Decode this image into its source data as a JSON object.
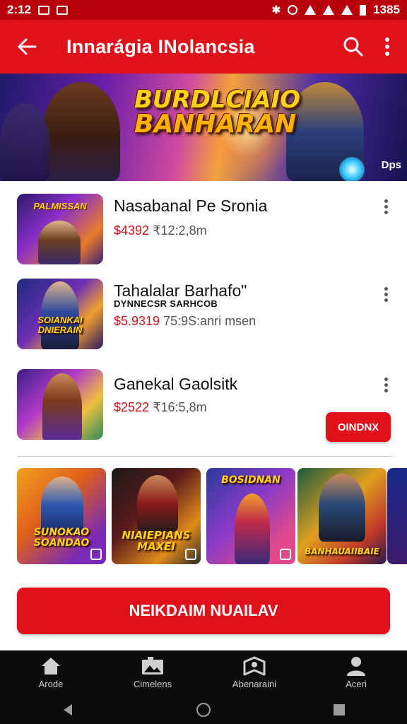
{
  "status_bar": {
    "time": "2:12",
    "battery": "1385"
  },
  "app_bar": {
    "title": "Innarágia INolancsia"
  },
  "banner": {
    "logo_line1": "BURDLCIAIO",
    "logo_line2": "BANHARAN",
    "corner_text": "Dps"
  },
  "items": [
    {
      "title": "Nasabanal Pe Sronia",
      "subtitle": "",
      "price": "$4392",
      "meta": "₹12:2,8m",
      "thumb_text": "PALMISSAN"
    },
    {
      "title": "Tahalalar Barhafo\"",
      "subtitle": "DYNNECSR SARHCOB",
      "price": "$5.9319",
      "meta": "75:9S:anri msen",
      "thumb_text": "SOIANKAI DNIERAIN"
    },
    {
      "title": "Ganekal Gaolsitk",
      "subtitle": "",
      "price": "$2522",
      "meta": "₹16:5,8m",
      "thumb_text": ""
    }
  ],
  "buy_button": {
    "label": "OINDNX"
  },
  "carousel": [
    {
      "title": "SUNOKAO SOANDAO"
    },
    {
      "title": "NIAIEPIANS MAXEI"
    },
    {
      "title": "BOSIDNAN"
    },
    {
      "title": "BANHAUAIIBAIE"
    }
  ],
  "cta": {
    "label": "NEIKDAIM NUAILAV"
  },
  "bottom_nav": [
    {
      "label": "Arode",
      "icon": "home-icon"
    },
    {
      "label": "Cimelens",
      "icon": "image-icon"
    },
    {
      "label": "Abenaraini",
      "icon": "map-icon"
    },
    {
      "label": "Aceri",
      "icon": "person-icon"
    }
  ],
  "colors": {
    "primary": "#e1111b",
    "status_bar": "#b8000d",
    "price": "#d0121c",
    "nav_bg": "#0b0b0b"
  }
}
